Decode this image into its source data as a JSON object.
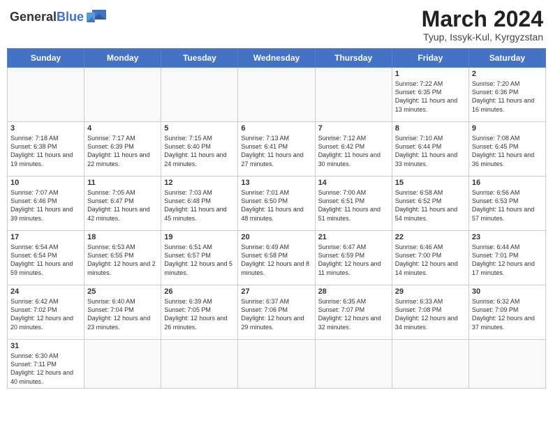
{
  "header": {
    "logo_general": "General",
    "logo_blue": "Blue",
    "month_year": "March 2024",
    "location": "Tyup, Issyk-Kul, Kyrgyzstan"
  },
  "weekdays": [
    "Sunday",
    "Monday",
    "Tuesday",
    "Wednesday",
    "Thursday",
    "Friday",
    "Saturday"
  ],
  "weeks": [
    [
      {
        "day": "",
        "info": ""
      },
      {
        "day": "",
        "info": ""
      },
      {
        "day": "",
        "info": ""
      },
      {
        "day": "",
        "info": ""
      },
      {
        "day": "",
        "info": ""
      },
      {
        "day": "1",
        "info": "Sunrise: 7:22 AM\nSunset: 6:35 PM\nDaylight: 11 hours and 13 minutes."
      },
      {
        "day": "2",
        "info": "Sunrise: 7:20 AM\nSunset: 6:36 PM\nDaylight: 11 hours and 16 minutes."
      }
    ],
    [
      {
        "day": "3",
        "info": "Sunrise: 7:18 AM\nSunset: 6:38 PM\nDaylight: 11 hours and 19 minutes."
      },
      {
        "day": "4",
        "info": "Sunrise: 7:17 AM\nSunset: 6:39 PM\nDaylight: 11 hours and 22 minutes."
      },
      {
        "day": "5",
        "info": "Sunrise: 7:15 AM\nSunset: 6:40 PM\nDaylight: 11 hours and 24 minutes."
      },
      {
        "day": "6",
        "info": "Sunrise: 7:13 AM\nSunset: 6:41 PM\nDaylight: 11 hours and 27 minutes."
      },
      {
        "day": "7",
        "info": "Sunrise: 7:12 AM\nSunset: 6:42 PM\nDaylight: 11 hours and 30 minutes."
      },
      {
        "day": "8",
        "info": "Sunrise: 7:10 AM\nSunset: 6:44 PM\nDaylight: 11 hours and 33 minutes."
      },
      {
        "day": "9",
        "info": "Sunrise: 7:08 AM\nSunset: 6:45 PM\nDaylight: 11 hours and 36 minutes."
      }
    ],
    [
      {
        "day": "10",
        "info": "Sunrise: 7:07 AM\nSunset: 6:46 PM\nDaylight: 11 hours and 39 minutes."
      },
      {
        "day": "11",
        "info": "Sunrise: 7:05 AM\nSunset: 6:47 PM\nDaylight: 11 hours and 42 minutes."
      },
      {
        "day": "12",
        "info": "Sunrise: 7:03 AM\nSunset: 6:48 PM\nDaylight: 11 hours and 45 minutes."
      },
      {
        "day": "13",
        "info": "Sunrise: 7:01 AM\nSunset: 6:50 PM\nDaylight: 11 hours and 48 minutes."
      },
      {
        "day": "14",
        "info": "Sunrise: 7:00 AM\nSunset: 6:51 PM\nDaylight: 11 hours and 51 minutes."
      },
      {
        "day": "15",
        "info": "Sunrise: 6:58 AM\nSunset: 6:52 PM\nDaylight: 11 hours and 54 minutes."
      },
      {
        "day": "16",
        "info": "Sunrise: 6:56 AM\nSunset: 6:53 PM\nDaylight: 11 hours and 57 minutes."
      }
    ],
    [
      {
        "day": "17",
        "info": "Sunrise: 6:54 AM\nSunset: 6:54 PM\nDaylight: 11 hours and 59 minutes."
      },
      {
        "day": "18",
        "info": "Sunrise: 6:53 AM\nSunset: 6:55 PM\nDaylight: 12 hours and 2 minutes."
      },
      {
        "day": "19",
        "info": "Sunrise: 6:51 AM\nSunset: 6:57 PM\nDaylight: 12 hours and 5 minutes."
      },
      {
        "day": "20",
        "info": "Sunrise: 6:49 AM\nSunset: 6:58 PM\nDaylight: 12 hours and 8 minutes."
      },
      {
        "day": "21",
        "info": "Sunrise: 6:47 AM\nSunset: 6:59 PM\nDaylight: 12 hours and 11 minutes."
      },
      {
        "day": "22",
        "info": "Sunrise: 6:46 AM\nSunset: 7:00 PM\nDaylight: 12 hours and 14 minutes."
      },
      {
        "day": "23",
        "info": "Sunrise: 6:44 AM\nSunset: 7:01 PM\nDaylight: 12 hours and 17 minutes."
      }
    ],
    [
      {
        "day": "24",
        "info": "Sunrise: 6:42 AM\nSunset: 7:02 PM\nDaylight: 12 hours and 20 minutes."
      },
      {
        "day": "25",
        "info": "Sunrise: 6:40 AM\nSunset: 7:04 PM\nDaylight: 12 hours and 23 minutes."
      },
      {
        "day": "26",
        "info": "Sunrise: 6:39 AM\nSunset: 7:05 PM\nDaylight: 12 hours and 26 minutes."
      },
      {
        "day": "27",
        "info": "Sunrise: 6:37 AM\nSunset: 7:06 PM\nDaylight: 12 hours and 29 minutes."
      },
      {
        "day": "28",
        "info": "Sunrise: 6:35 AM\nSunset: 7:07 PM\nDaylight: 12 hours and 32 minutes."
      },
      {
        "day": "29",
        "info": "Sunrise: 6:33 AM\nSunset: 7:08 PM\nDaylight: 12 hours and 34 minutes."
      },
      {
        "day": "30",
        "info": "Sunrise: 6:32 AM\nSunset: 7:09 PM\nDaylight: 12 hours and 37 minutes."
      }
    ],
    [
      {
        "day": "31",
        "info": "Sunrise: 6:30 AM\nSunset: 7:11 PM\nDaylight: 12 hours and 40 minutes."
      },
      {
        "day": "",
        "info": ""
      },
      {
        "day": "",
        "info": ""
      },
      {
        "day": "",
        "info": ""
      },
      {
        "day": "",
        "info": ""
      },
      {
        "day": "",
        "info": ""
      },
      {
        "day": "",
        "info": ""
      }
    ]
  ]
}
